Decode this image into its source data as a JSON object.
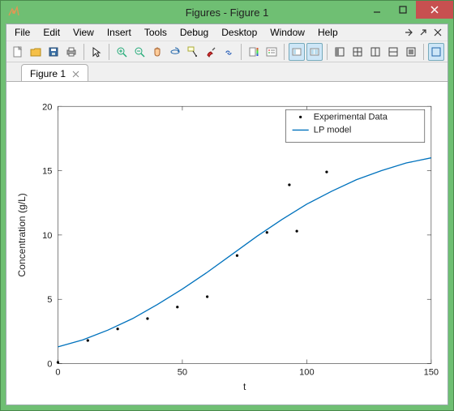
{
  "window": {
    "title": "Figures - Figure 1"
  },
  "menu": [
    "File",
    "Edit",
    "View",
    "Insert",
    "Tools",
    "Debug",
    "Desktop",
    "Window",
    "Help"
  ],
  "toolbar": {
    "new": "new-file-icon",
    "open": "open-folder-icon",
    "save": "save-icon",
    "print": "print-icon",
    "edit": "arrow-cursor-icon",
    "zoomin": "zoom-in-icon",
    "zoomout": "zoom-out-icon",
    "pan": "pan-hand-icon",
    "rotate": "rotate-3d-icon",
    "datacursor": "data-cursor-icon",
    "brush": "brush-icon",
    "link": "link-plots-icon",
    "colorbar": "colorbar-icon",
    "legend": "insert-legend-icon",
    "hideplot": "hide-plot-tools-icon",
    "floatleft": "float-left-icon",
    "floatsplit": "float-split-icon",
    "tile": "tile-icon",
    "tileh": "tile-h-icon",
    "tilev": "tile-v-icon",
    "tilegrid": "tile-grid-icon",
    "maxfig": "maximize-figure-icon"
  },
  "tabs": [
    {
      "label": "Figure 1"
    }
  ],
  "chart_data": {
    "type": "line+scatter",
    "xlabel": "t",
    "ylabel": "Concentration (g/L)",
    "xlim": [
      0,
      150
    ],
    "ylim": [
      0,
      20
    ],
    "xticks": [
      0,
      50,
      100,
      150
    ],
    "yticks": [
      0,
      5,
      10,
      15,
      20
    ],
    "series": [
      {
        "name": "Experimental Data",
        "type": "scatter",
        "marker": "dot",
        "color": "#000000",
        "x": [
          0,
          12,
          24,
          36,
          48,
          60,
          72,
          84,
          93,
          96,
          108
        ],
        "y": [
          0.1,
          1.8,
          2.7,
          3.5,
          4.4,
          5.2,
          8.4,
          10.2,
          13.9,
          10.3,
          14.9
        ]
      },
      {
        "name": "LP model",
        "type": "line",
        "color": "#0072bd",
        "x": [
          0,
          10,
          20,
          30,
          40,
          50,
          60,
          70,
          80,
          90,
          100,
          110,
          120,
          130,
          140,
          150
        ],
        "y": [
          1.3,
          1.85,
          2.6,
          3.5,
          4.6,
          5.8,
          7.1,
          8.5,
          9.9,
          11.2,
          12.4,
          13.4,
          14.3,
          15.0,
          15.6,
          16.0
        ]
      }
    ],
    "legend": {
      "position": "upper-right",
      "entries": [
        "Experimental Data",
        "LP model"
      ]
    }
  }
}
